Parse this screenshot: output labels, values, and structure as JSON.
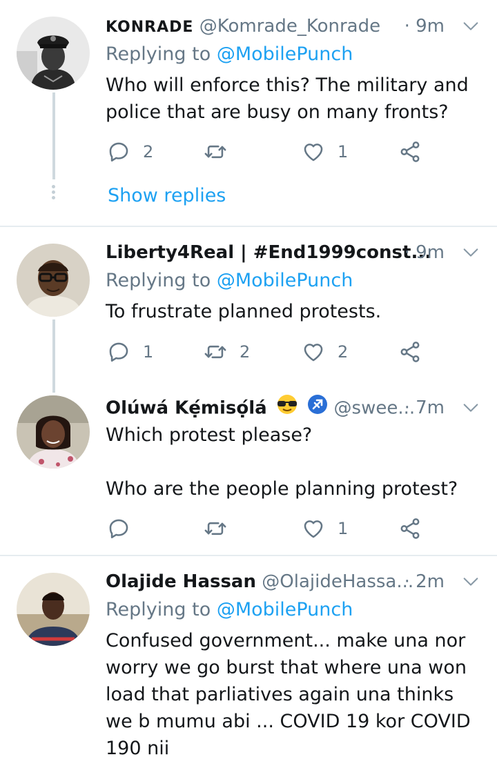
{
  "tweets": [
    {
      "name": "KONRADE",
      "handle": "@Komrade_Konrade",
      "time": "· 9m",
      "replying_prefix": "Replying to ",
      "replying_to": "@MobilePunch",
      "text": "Who will enforce this? The military and police that are busy on many fronts?",
      "replies": "2",
      "retweets": "",
      "likes": "1",
      "show_replies": "Show replies"
    },
    {
      "name": "Liberty4Real | #End1999const...",
      "handle": "",
      "time": "· 9m",
      "replying_prefix": "Replying to ",
      "replying_to": "@MobilePunch",
      "text": "To frustrate planned protests.",
      "replies": "1",
      "retweets": "2",
      "likes": "2"
    },
    {
      "name": "Olúwá Kẹ́misọ́lá",
      "handle": "@swee...",
      "time": "· 7m",
      "text": "Which protest please?\n\nWho are the people planning protest?",
      "replies": "",
      "retweets": "",
      "likes": "1"
    },
    {
      "name": "Olajide Hassan",
      "handle": "@OlajideHassa...",
      "time": "· 2m",
      "replying_prefix": "Replying to ",
      "replying_to": "@MobilePunch",
      "text": "Confused government... make una nor worry we go burst that where una won load that parliatives again una thinks we b mumu abi ... COVID 19 kor COVID 190 nii"
    }
  ],
  "colors": {
    "link": "#1da1f2",
    "secondary": "#657786",
    "divider": "#e6ecf0",
    "thread_line": "#cfd9de"
  },
  "icons": [
    "reply-icon",
    "retweet-icon",
    "like-icon",
    "share-icon",
    "chevron-down-icon",
    "sunglasses-emoji-icon",
    "sagittarius-emoji-icon"
  ]
}
